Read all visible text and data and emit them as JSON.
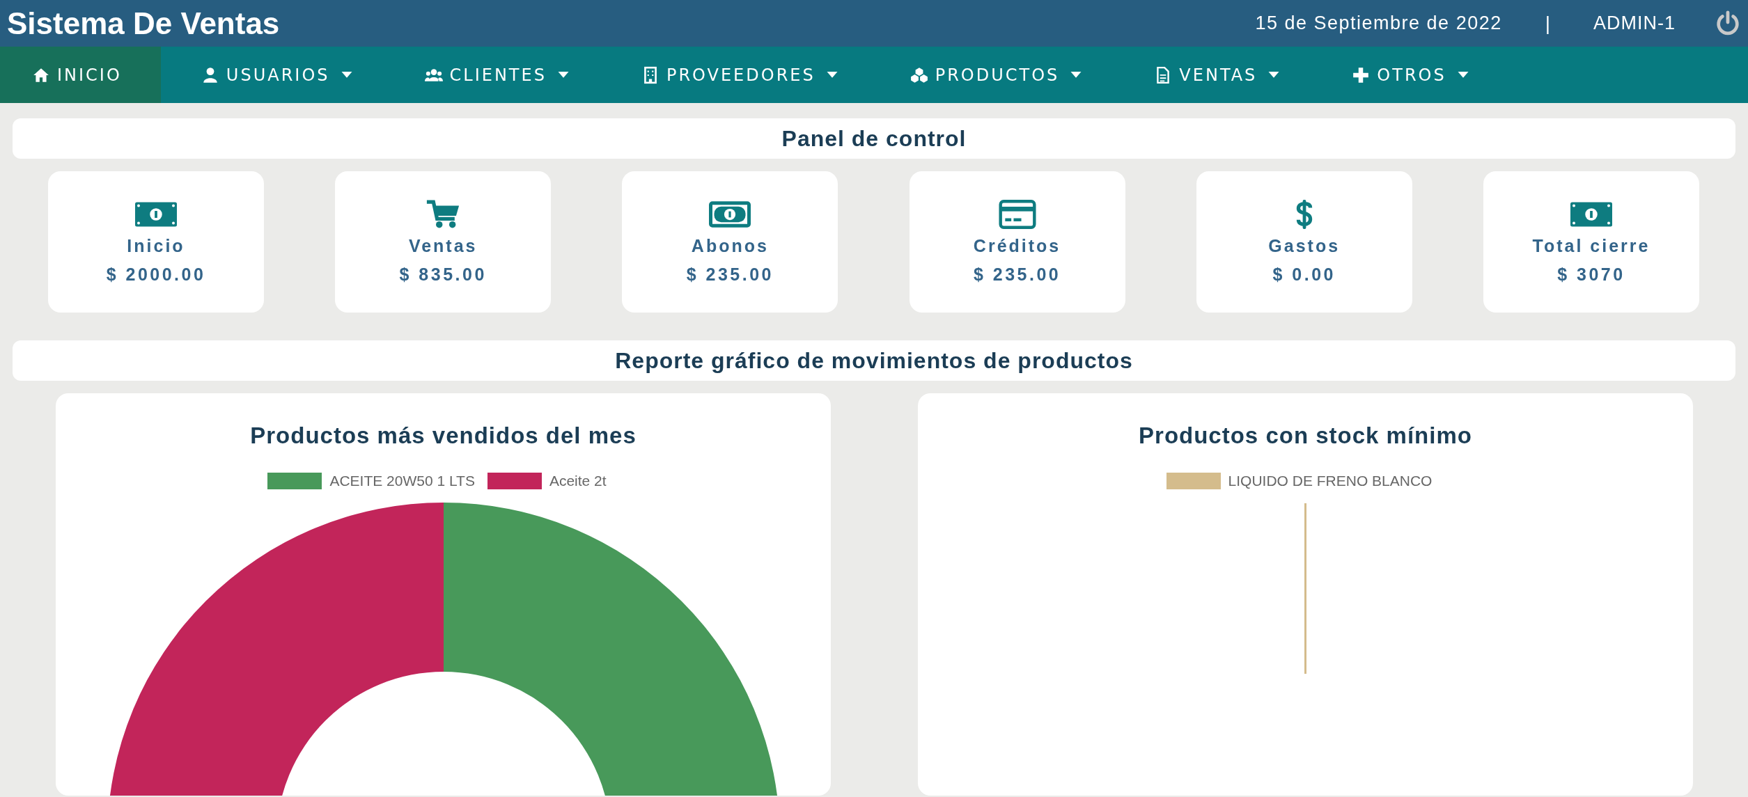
{
  "header": {
    "title": "Sistema De Ventas",
    "date": "15 de Septiembre de 2022",
    "separator": "|",
    "user": "ADMIN-1"
  },
  "nav": [
    {
      "label": "INICIO",
      "selected": true,
      "dropdown": false
    },
    {
      "label": "USUARIOS",
      "selected": false,
      "dropdown": true
    },
    {
      "label": "CLIENTES",
      "selected": false,
      "dropdown": true
    },
    {
      "label": "PROVEEDORES",
      "selected": false,
      "dropdown": true
    },
    {
      "label": "PRODUCTOS",
      "selected": false,
      "dropdown": true
    },
    {
      "label": "VENTAS",
      "selected": false,
      "dropdown": true
    },
    {
      "label": "OTROS",
      "selected": false,
      "dropdown": true
    }
  ],
  "panel": {
    "title": "Panel de control"
  },
  "cards": [
    {
      "label": "Inicio",
      "value": "$ 2000.00"
    },
    {
      "label": "Ventas",
      "value": "$ 835.00"
    },
    {
      "label": "Abonos",
      "value": "$ 235.00"
    },
    {
      "label": "Créditos",
      "value": "$ 235.00"
    },
    {
      "label": "Gastos",
      "value": "$ 0.00"
    },
    {
      "label": "Total cierre",
      "value": "$ 3070"
    }
  ],
  "report": {
    "title": "Reporte gráfico de movimientos de productos"
  },
  "charts": [
    {
      "title": "Productos más vendidos del mes",
      "kind": "donut",
      "legend": [
        {
          "label": "ACEITE 20W50 1 LTS",
          "color": "#48995a"
        },
        {
          "label": "Aceite 2t",
          "color": "#c2255a"
        }
      ]
    },
    {
      "title": "Productos con stock mínimo",
      "kind": "line",
      "legend": [
        {
          "label": "LIQUIDO DE FRENO BLANCO",
          "color": "#d4bc8c"
        }
      ]
    }
  ]
}
